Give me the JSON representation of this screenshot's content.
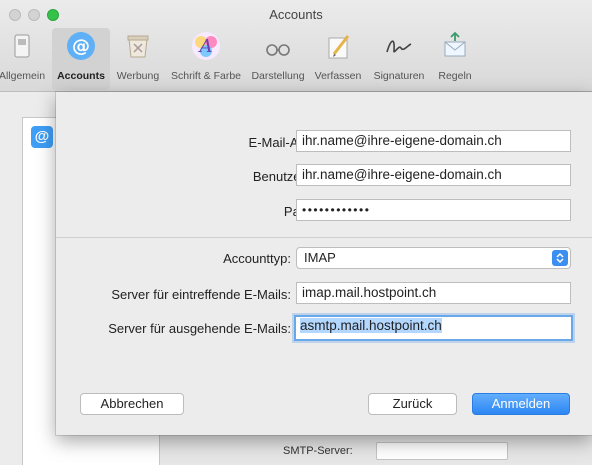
{
  "window": {
    "title": "Accounts"
  },
  "toolbar": {
    "items": [
      {
        "label": "Allgemein",
        "icon": "general-icon"
      },
      {
        "label": "Accounts",
        "icon": "at-icon"
      },
      {
        "label": "Werbung",
        "icon": "junk-icon"
      },
      {
        "label": "Schrift & Farbe",
        "icon": "fonts-colors-icon"
      },
      {
        "label": "Darstellung",
        "icon": "viewing-glasses-icon"
      },
      {
        "label": "Verfassen",
        "icon": "compose-icon"
      },
      {
        "label": "Signaturen",
        "icon": "signature-icon"
      },
      {
        "label": "Regeln",
        "icon": "rules-icon"
      }
    ],
    "active": "Accounts"
  },
  "background": {
    "smtp_label": "SMTP-Server:"
  },
  "sheet": {
    "email_label": "E-Mail-Adresse:",
    "email_value": "ihr.name@ihre-eigene-domain.ch",
    "username_label": "Benutzername:",
    "username_value": "ihr.name@ihre-eigene-domain.ch",
    "password_label": "Passwort:",
    "password_value": "••••••••••••",
    "accounttype_label": "Accounttyp:",
    "accounttype_value": "IMAP",
    "incoming_label": "Server für eintreffende E-Mails:",
    "incoming_value": "imap.mail.hostpoint.ch",
    "outgoing_label": "Server für ausgehende E-Mails:",
    "outgoing_value": "asmtp.mail.hostpoint.ch",
    "cancel_label": "Abbrechen",
    "back_label": "Zurück",
    "signin_label": "Anmelden"
  },
  "colors": {
    "accent": "#2c86f3",
    "selection": "#b3d7ff",
    "close_green": "#35c24a"
  }
}
